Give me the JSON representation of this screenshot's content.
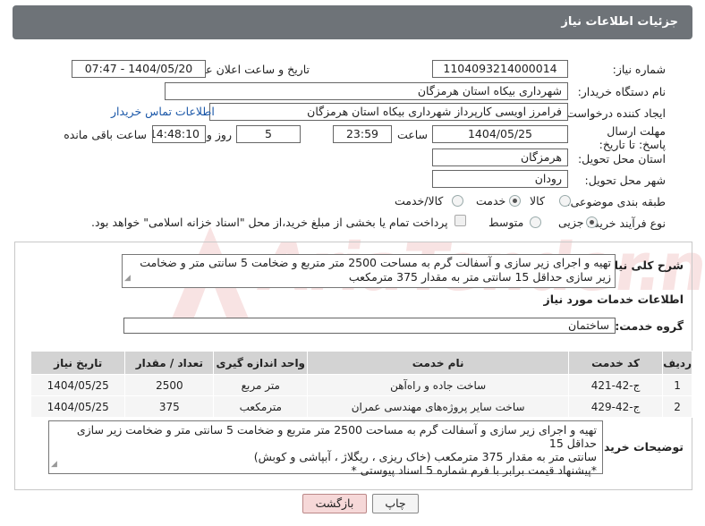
{
  "header": {
    "title": "جزئیات اطلاعات نیاز"
  },
  "fields": {
    "need_number_label": "شماره نیاز:",
    "need_number": "1104093214000014",
    "announce_label": "تاریخ و ساعت اعلان عمومی:",
    "announce_value": "1404/05/20 - 07:47",
    "buyer_org_label": "نام دستگاه خریدار:",
    "buyer_org": "شهرداری بیکاه استان هرمزگان",
    "creator_label": "ایجاد کننده درخواست:",
    "creator": "فرامرز اویسی کارپرداز شهرداری بیکاه استان هرمزگان",
    "contact_link": "اطلاعات تماس خریدار",
    "deadline_label": "مهلت ارسال پاسخ: تا تاریخ:",
    "deadline_date": "1404/05/25",
    "time_label": "ساعت",
    "deadline_time": "23:59",
    "days_value": "5",
    "days_label": "روز و",
    "remaining_time": "14:48:10",
    "remaining_label": "ساعت باقی مانده",
    "province_label": "استان محل تحویل:",
    "province": "هرمزگان",
    "city_label": "شهر محل تحویل:",
    "city": "رودان",
    "category_label": "طبقه بندی موضوعی:",
    "category_options": [
      "کالا",
      "خدمت",
      "کالا/خدمت"
    ],
    "process_label": "نوع فرآیند خرید :",
    "process_options": [
      "جزیی",
      "متوسط"
    ],
    "payment_note": "پرداخت تمام یا بخشی از مبلغ خرید،از محل \"اسناد خزانه اسلامی\" خواهد بود."
  },
  "summary": {
    "label": "شرح کلی نیاز:",
    "text": "تهیه و اجرای زیر سازی و آسفالت گرم به مساحت 2500 متر متربع و ضخامت 5 سانتی متر و ضخامت زیر سازی حداقل 15 سانتی متر به مقدار 375 مترمکعب"
  },
  "services": {
    "section_title": "اطلاعات خدمات مورد نیاز",
    "group_label": "گروه خدمت:",
    "group_value": "ساختمان",
    "columns": [
      "ردیف",
      "کد خدمت",
      "نام خدمت",
      "واحد اندازه گیری",
      "تعداد / مقدار",
      "تاریخ نیاز"
    ],
    "rows": [
      [
        "1",
        "ج-42-421",
        "ساخت جاده و راه‌آهن",
        "متر مربع",
        "2500",
        "1404/05/25"
      ],
      [
        "2",
        "ج-42-429",
        "ساخت سایر پروژه‌های مهندسی عمران",
        "مترمکعب",
        "375",
        "1404/05/25"
      ]
    ]
  },
  "buyer_notes": {
    "label": "توضیحات خریدار:",
    "line1": "تهیه و اجرای زیر سازی و آسفالت گرم به مساحت 2500 متر متربع و ضخامت 5 سانتی متر و ضخامت زیر سازی حداقل 15",
    "line2": "سانتی متر به مقدار 375 مترمکعب (خاک ریزی ، ریگلاژ ، آبپاشی و کوبش)",
    "line3": "*پیشنهاد قیمت برابر با فرم شماره 5 اسناد پیوستی *"
  },
  "buttons": {
    "print": "چاپ",
    "back": "بازگشت"
  },
  "watermark": {
    "text": "AriaTender.neT"
  }
}
